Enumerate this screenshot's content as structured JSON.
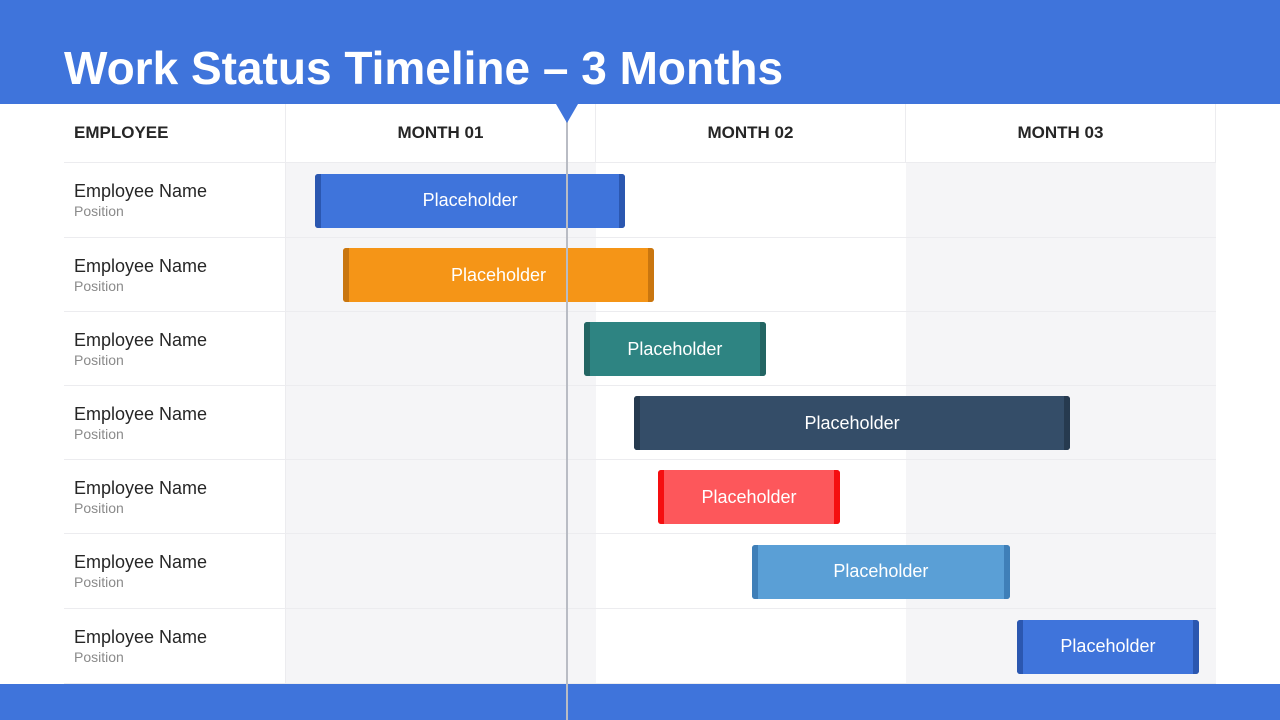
{
  "title": "Work Status Timeline – 3 Months",
  "colors": {
    "brand": "#3f74db",
    "stripe": "#f5f5f7",
    "grid": "#ececef"
  },
  "columns": {
    "employee": "EMPLOYEE",
    "months": [
      "MONTH 01",
      "MONTH 02",
      "MONTH 03"
    ]
  },
  "today_marker_month": 0.906,
  "rows": [
    {
      "name": "Employee Name",
      "position": "Position",
      "task": "Placeholder",
      "start_month": 0.094,
      "end_month": 1.094,
      "color": "#3f74db",
      "edge": "#2b57b0"
    },
    {
      "name": "Employee Name",
      "position": "Position",
      "task": "Placeholder",
      "start_month": 0.184,
      "end_month": 1.187,
      "color": "#f59517",
      "edge": "#c9760f"
    },
    {
      "name": "Employee Name",
      "position": "Position",
      "task": "Placeholder",
      "start_month": 0.961,
      "end_month": 1.548,
      "color": "#2e8482",
      "edge": "#236563"
    },
    {
      "name": "Employee Name",
      "position": "Position",
      "task": "Placeholder",
      "start_month": 1.123,
      "end_month": 2.529,
      "color": "#344d68",
      "edge": "#263a4f"
    },
    {
      "name": "Employee Name",
      "position": "Position",
      "task": "Placeholder",
      "start_month": 1.2,
      "end_month": 1.787,
      "color": "#fd575b",
      "edge": "#f50e10"
    },
    {
      "name": "Employee Name",
      "position": "Position",
      "task": "Placeholder",
      "start_month": 1.503,
      "end_month": 2.335,
      "color": "#5a9fd6",
      "edge": "#3f7fb8"
    },
    {
      "name": "Employee Name",
      "position": "Position",
      "task": "Placeholder",
      "start_month": 2.358,
      "end_month": 2.945,
      "color": "#3f74db",
      "edge": "#2b57b0"
    }
  ]
}
